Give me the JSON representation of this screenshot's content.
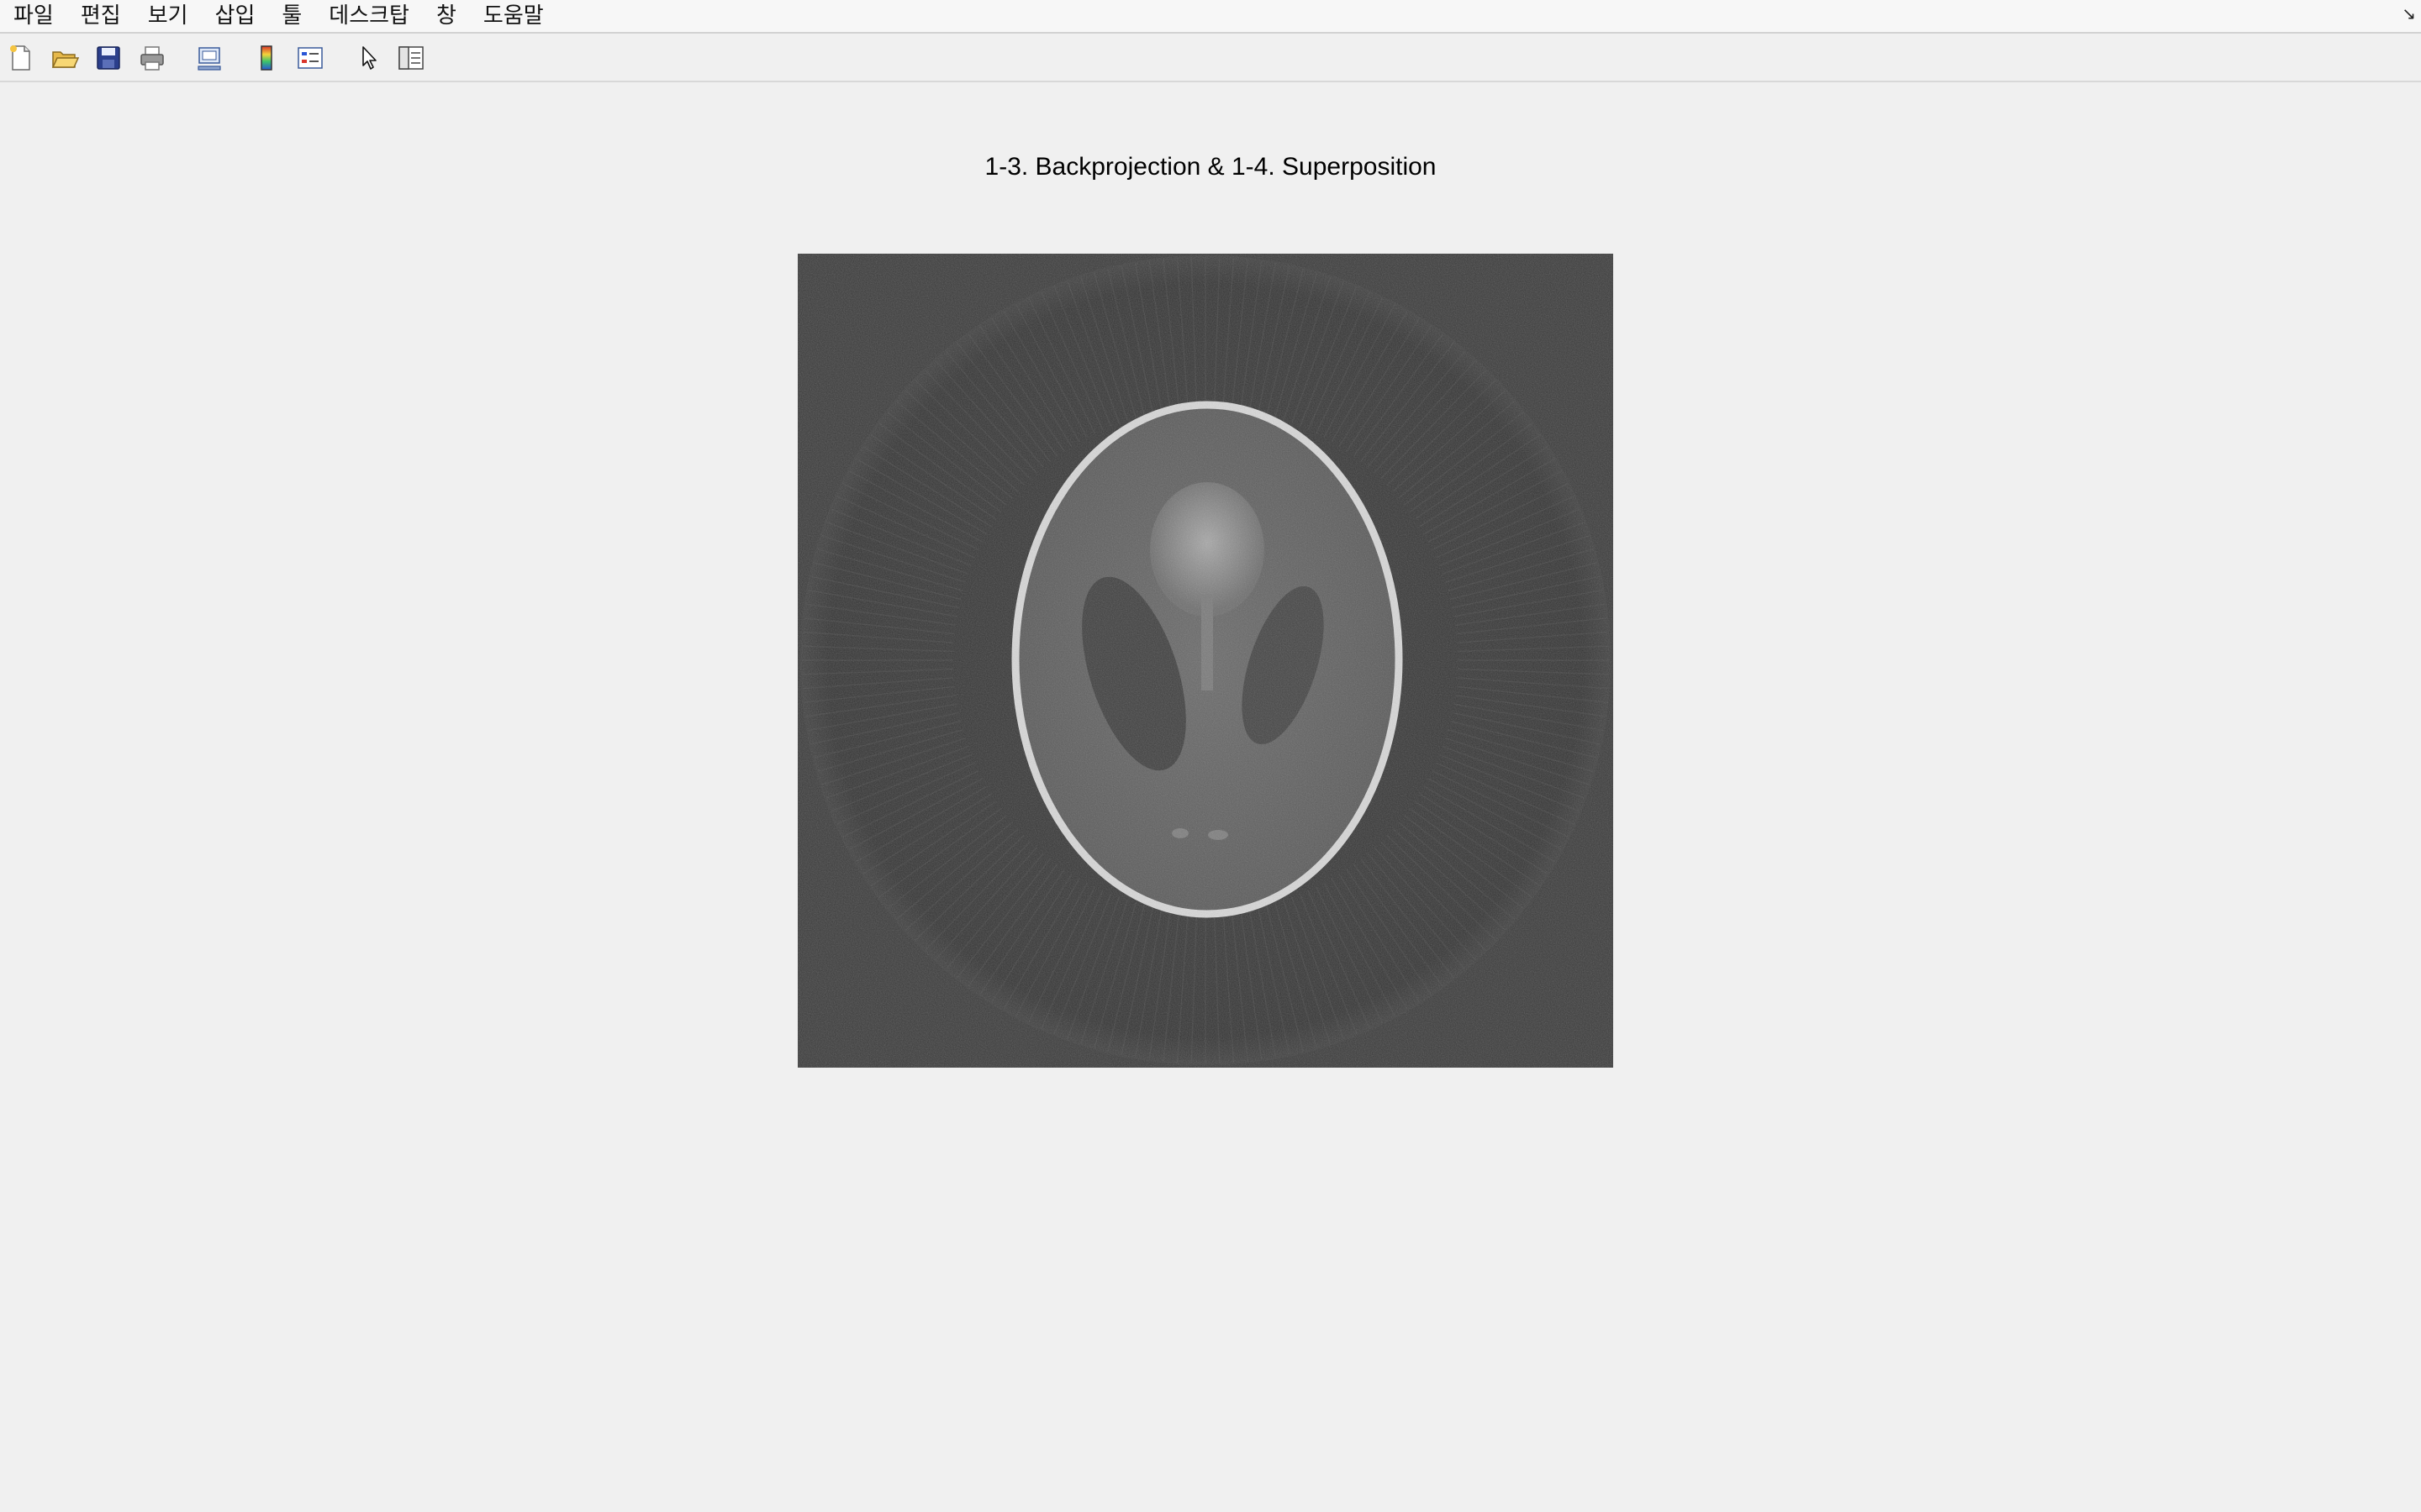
{
  "menubar": {
    "items": [
      {
        "label": "파일"
      },
      {
        "label": "편집"
      },
      {
        "label": "보기"
      },
      {
        "label": "삽입"
      },
      {
        "label": "툴"
      },
      {
        "label": "데스크탑"
      },
      {
        "label": "창"
      },
      {
        "label": "도움말"
      }
    ],
    "dock_glyph": "↘"
  },
  "toolbar": {
    "buttons": [
      {
        "icon": "new-figure-icon"
      },
      {
        "icon": "open-file-icon"
      },
      {
        "icon": "save-icon"
      },
      {
        "icon": "print-icon"
      },
      {
        "icon": "link-plot-icon"
      },
      {
        "icon": "colorbar-icon"
      },
      {
        "icon": "legend-icon"
      },
      {
        "icon": "pointer-icon"
      },
      {
        "icon": "property-inspector-icon"
      }
    ]
  },
  "figure": {
    "title": "1-3. Backprojection & 1-4. Superposition",
    "image": {
      "description_colormap": "gray",
      "background_gray": "#3a3a3a"
    }
  }
}
